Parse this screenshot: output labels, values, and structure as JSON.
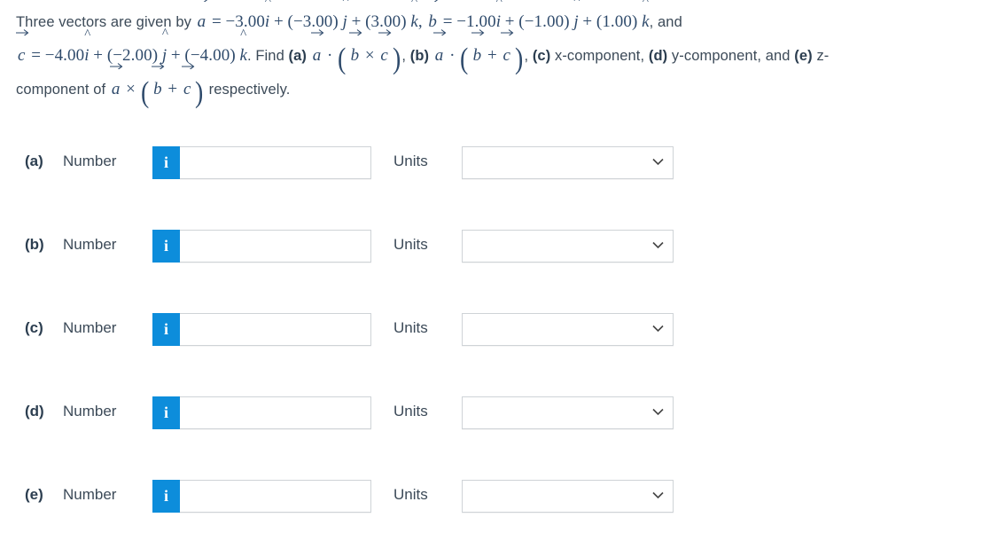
{
  "problem": {
    "intro": "Three vectors are given by",
    "vector_a_name": "a",
    "vector_b_name": "b",
    "vector_c_name": "c",
    "a_i": "−3.00",
    "a_j": "(−3.00)",
    "a_k": "(3.00)",
    "b_i": "−1.00",
    "b_j": "(−1.00)",
    "b_k": "(1.00)",
    "c_i": "−4.00",
    "c_j": "(−2.00)",
    "c_k": "(−4.00)",
    "and_word": ", and",
    "find_word": ". Find",
    "label_a": "(a)",
    "label_b": "(b)",
    "label_c": "(c)",
    "label_d": "(d)",
    "label_e": "(e)",
    "part_c_text": "x-component,",
    "part_d_text": "y-component, and",
    "part_e_text": "z-component of",
    "closing": "respectively.",
    "comma": ",",
    "i_hat": "i",
    "j_hat": "j",
    "k_hat": "k",
    "equals": "=",
    "plus": "+",
    "dot": "·",
    "cross": "×",
    "hat_mark": "^"
  },
  "answers": {
    "number_label": "Number",
    "units_label": "Units",
    "info_icon_text": "i",
    "rows": [
      {
        "tag": "(a)",
        "number_value": "",
        "number_placeholder": "",
        "units_value": "",
        "options": [
          ""
        ]
      },
      {
        "tag": "(b)",
        "number_value": "",
        "number_placeholder": "",
        "units_value": "",
        "options": [
          ""
        ]
      },
      {
        "tag": "(c)",
        "number_value": "",
        "number_placeholder": "",
        "units_value": "",
        "options": [
          ""
        ]
      },
      {
        "tag": "(d)",
        "number_value": "",
        "number_placeholder": "",
        "units_value": "",
        "options": [
          ""
        ]
      },
      {
        "tag": "(e)",
        "number_value": "",
        "number_placeholder": "",
        "units_value": "",
        "options": [
          ""
        ]
      }
    ]
  },
  "colors": {
    "accent_blue": "#0d8ddb",
    "text": "#3c4a58",
    "math": "#2e4a6b",
    "border": "#cfd3d7"
  }
}
